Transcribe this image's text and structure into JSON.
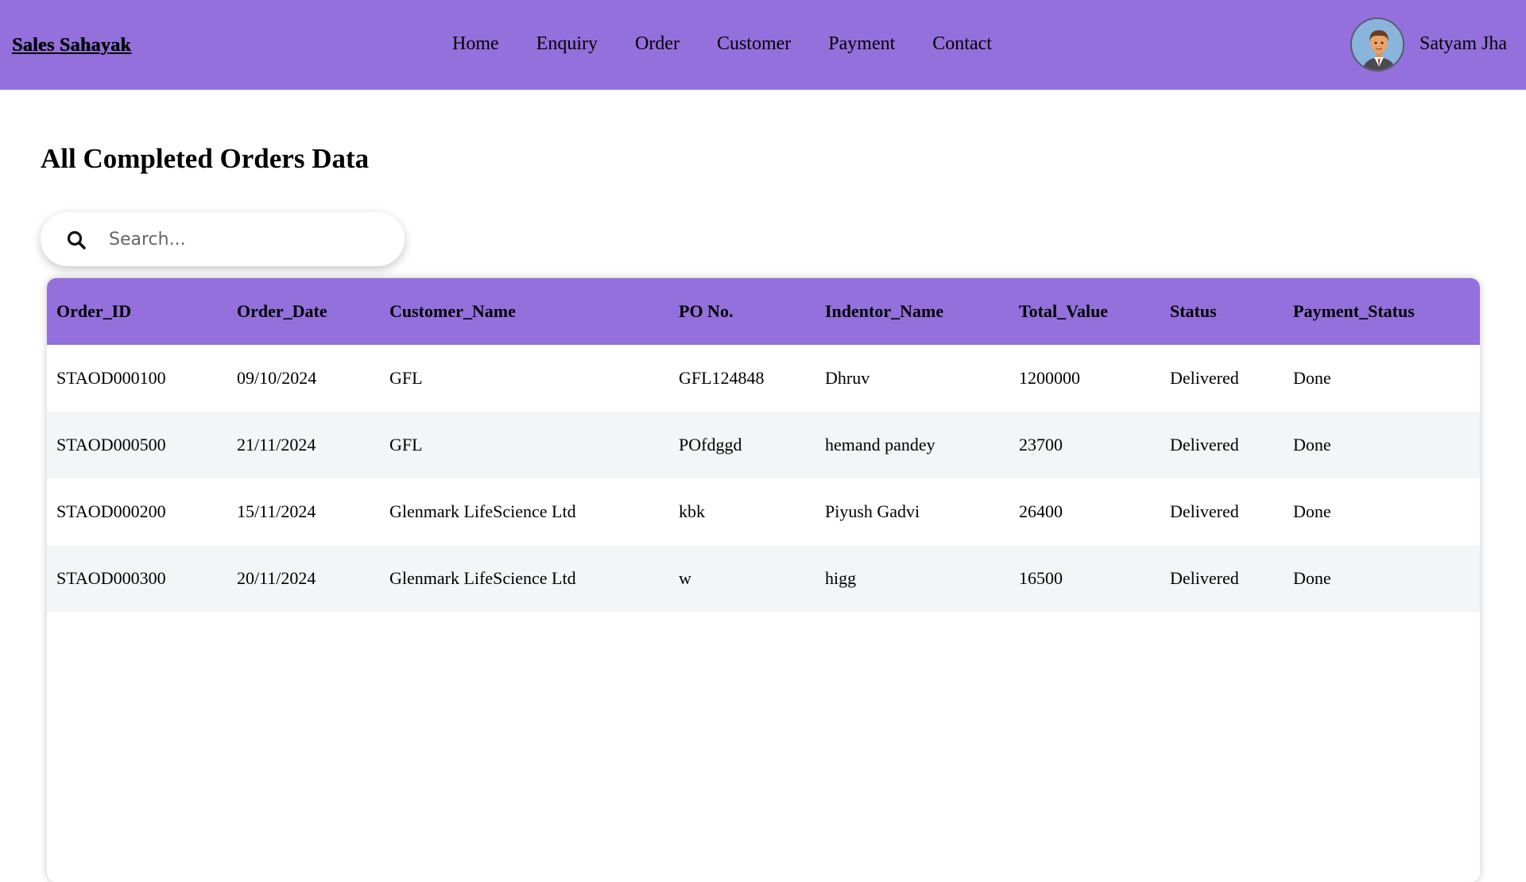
{
  "brand": "Sales Sahayak",
  "nav": [
    "Home",
    "Enquiry",
    "Order",
    "Customer",
    "Payment",
    "Contact"
  ],
  "user": {
    "name": "Satyam Jha"
  },
  "page_title": "All Completed Orders Data",
  "search": {
    "placeholder": "Search..."
  },
  "table": {
    "headers": [
      "Order_ID",
      "Order_Date",
      "Customer_Name",
      "PO No.",
      "Indentor_Name",
      "Total_Value",
      "Status",
      "Payment_Status"
    ],
    "rows": [
      [
        "STAOD000100",
        "09/10/2024",
        "GFL",
        "GFL124848",
        "Dhruv",
        "1200000",
        "Delivered",
        "Done"
      ],
      [
        "STAOD000500",
        "21/11/2024",
        "GFL",
        "POfdggd",
        "hemand pandey",
        "23700",
        "Delivered",
        "Done"
      ],
      [
        "STAOD000200",
        "15/11/2024",
        "Glenmark LifeScience Ltd",
        "kbk",
        "Piyush Gadvi",
        "26400",
        "Delivered",
        "Done"
      ],
      [
        "STAOD000300",
        "20/11/2024",
        "Glenmark LifeScience Ltd",
        "w",
        "higg",
        "16500",
        "Delivered",
        "Done"
      ]
    ]
  },
  "colors": {
    "accent": "#9370db",
    "row_alt": "#f4f5f7"
  }
}
